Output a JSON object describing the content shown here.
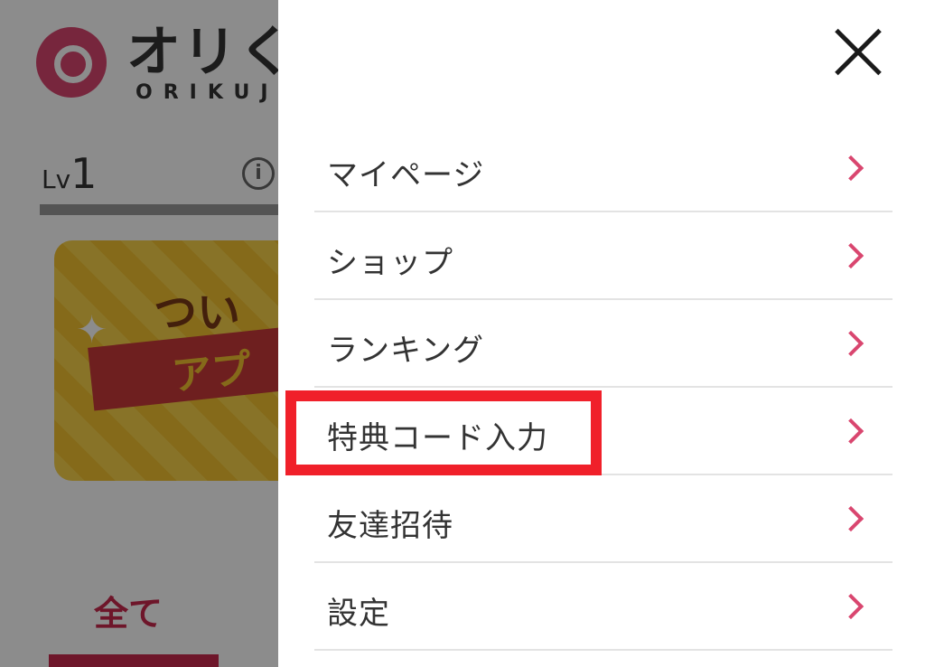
{
  "background": {
    "logo_text": "オリく",
    "logo_sub": "ORIKUJ",
    "level_label": "Lv",
    "level_value": "1",
    "info_icon": "i",
    "banner_line1": "つい",
    "banner_line2": "アプ",
    "tab_all": "全て"
  },
  "menu": {
    "items": [
      {
        "label": "マイページ"
      },
      {
        "label": "ショップ"
      },
      {
        "label": "ランキング"
      },
      {
        "label": "特典コード入力"
      },
      {
        "label": "友達招待"
      },
      {
        "label": "設定"
      }
    ]
  },
  "colors": {
    "accent": "#d9466f",
    "highlight": "#f0202a"
  }
}
